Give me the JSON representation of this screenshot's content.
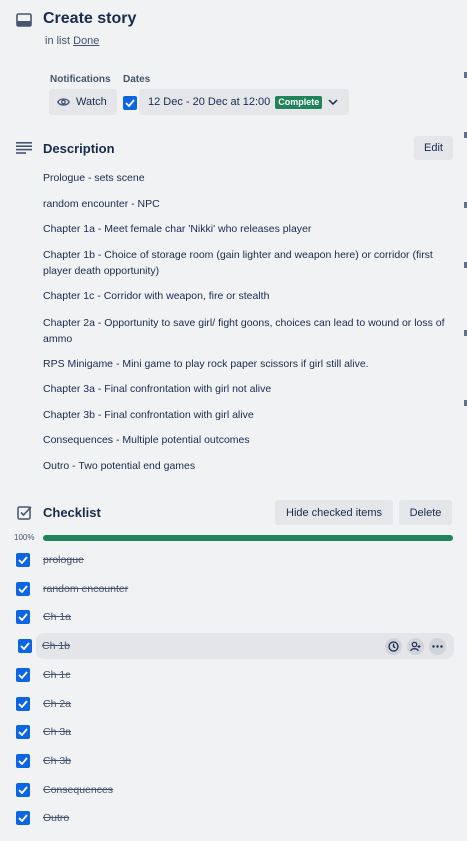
{
  "card": {
    "title": "Create story",
    "in_list_prefix": "in list",
    "list_name": "Done"
  },
  "meta": {
    "notifications_label": "Notifications",
    "dates_label": "Dates",
    "watch_label": "Watch",
    "date_range": "12 Dec - 20 Dec at 12:00",
    "date_status": "Complete",
    "colors": {
      "complete": "#1f845a",
      "checkbox": "#0c66e4"
    }
  },
  "description": {
    "title": "Description",
    "edit_label": "Edit",
    "lines": [
      "Prologue - sets scene",
      "random encounter - NPC",
      "Chapter 1a - Meet female char 'Nikki' who releases player",
      "Chapter 1b - Choice of storage room (gain lighter and weapon here) or corridor (first player death opportunity)",
      "Chapter 1c - Corridor with weapon, fire or stealth",
      "Chapter 2a - Opportunity to save girl/ fight goons, choices can lead to wound or loss of ammo",
      "RPS Minigame - Mini game to play rock paper scissors if girl still alive.",
      "Chapter 3a - Final confrontation with girl not alive",
      "Chapter 3b - Final confrontation with girl alive",
      "Consequences - Multiple potential outcomes",
      "Outro - Two potential end games"
    ]
  },
  "checklist": {
    "title": "Checklist",
    "hide_label": "Hide checked items",
    "delete_label": "Delete",
    "progress_text": "100%",
    "progress": 1.0,
    "items": [
      "prologue",
      "random encounter",
      "Ch 1a",
      "Ch 1b",
      "Ch 1c",
      "Ch 2a",
      "Ch 3a",
      "Ch 3b",
      "Consequences",
      "Outro"
    ]
  }
}
